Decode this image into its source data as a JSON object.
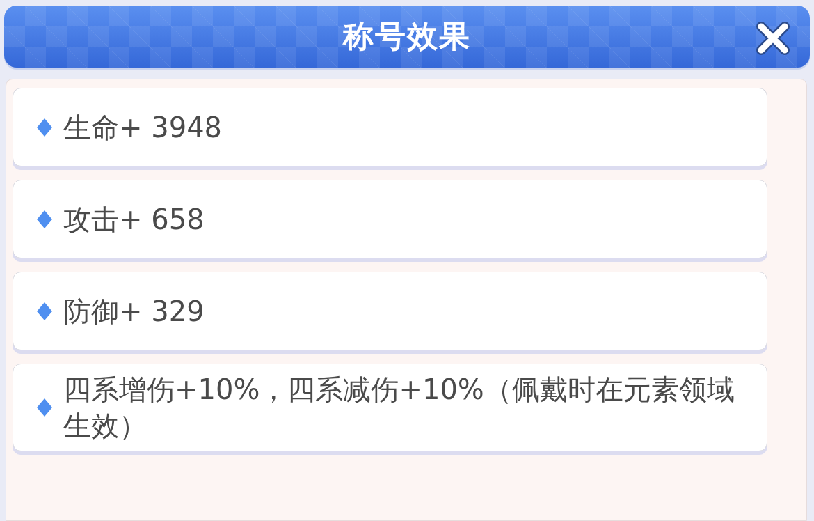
{
  "title": "称号效果",
  "effects": [
    {
      "text": "生命+ 3948"
    },
    {
      "text": "攻击+ 658"
    },
    {
      "text": "防御+ 329"
    },
    {
      "text": "四系增伤+10%，四系减伤+10%（佩戴时在元素领域生效）"
    }
  ]
}
